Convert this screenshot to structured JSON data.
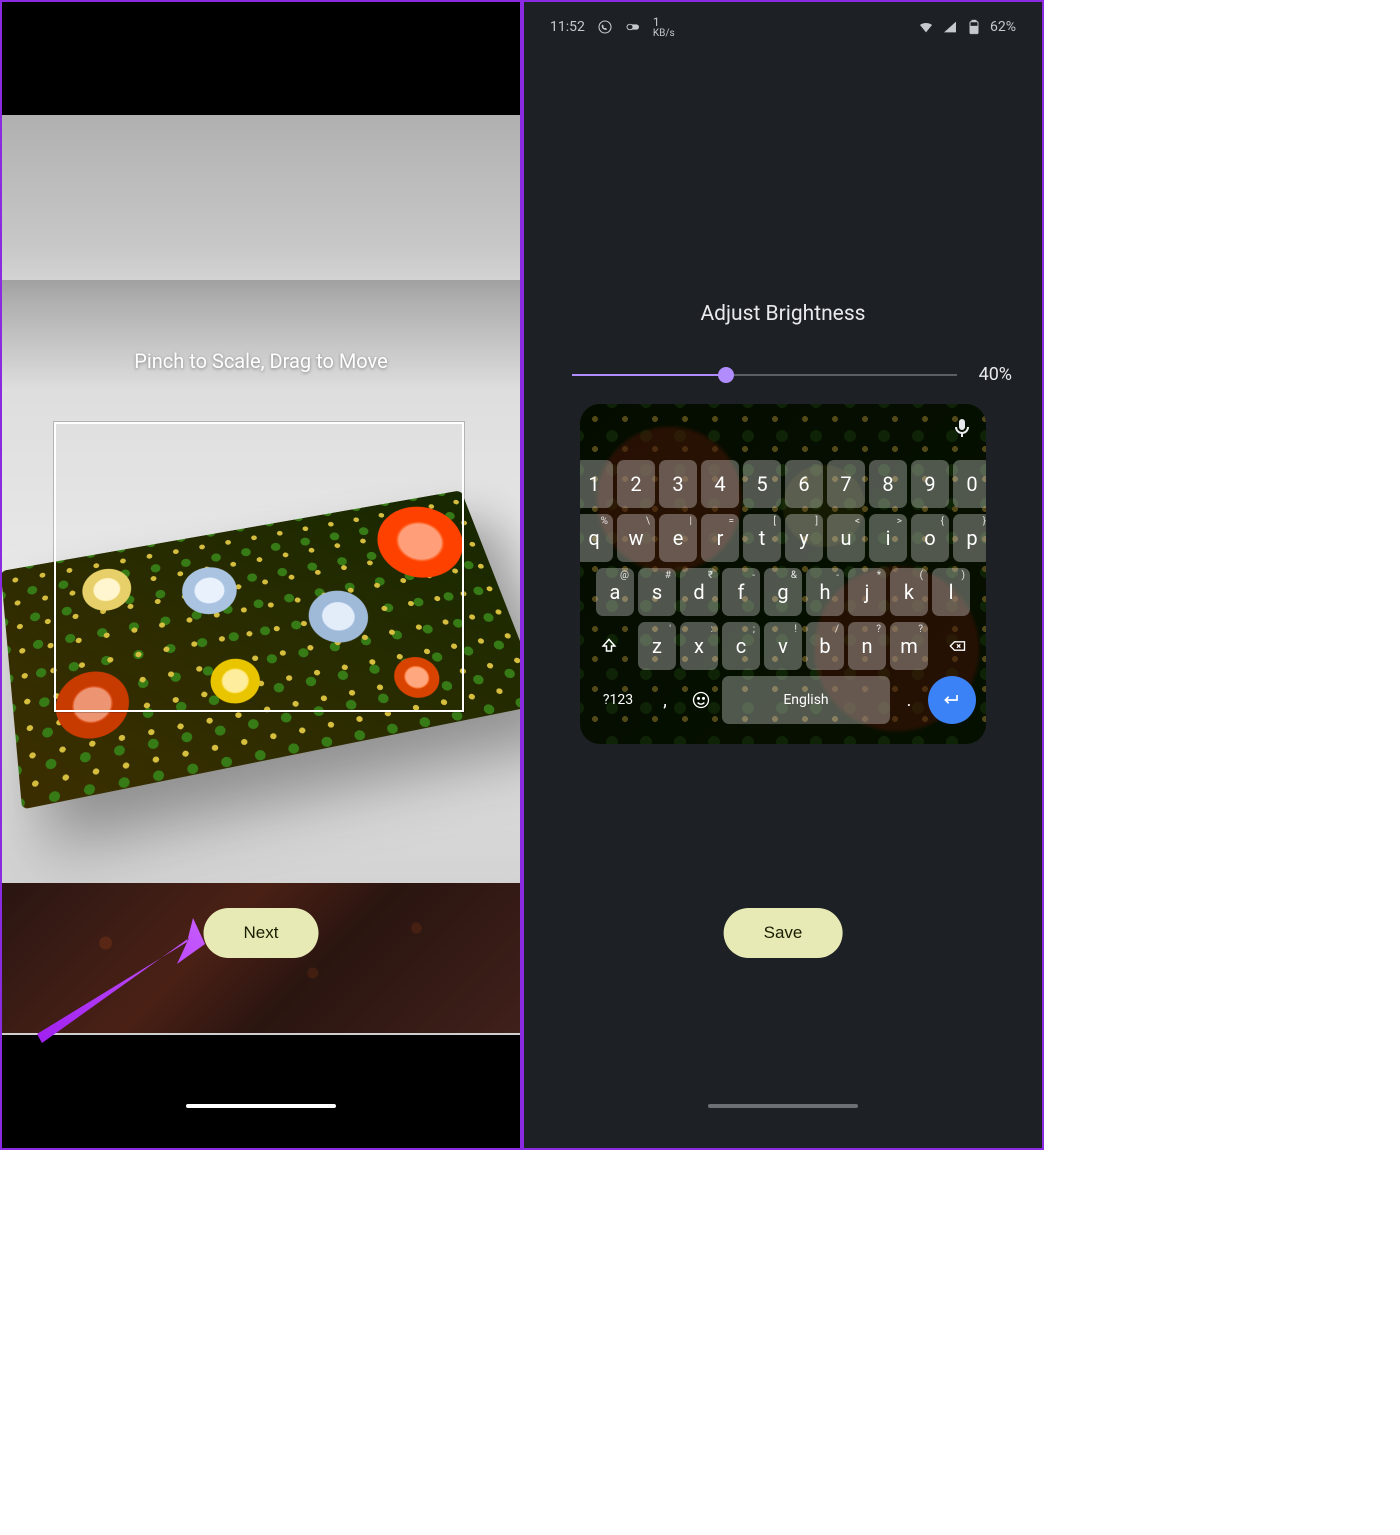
{
  "left": {
    "hint": "Pinch to Scale, Drag to Move",
    "next_label": "Next"
  },
  "right": {
    "status": {
      "time": "11:52",
      "net_value": "1",
      "net_unit": "KB/s",
      "battery_text": "62%"
    },
    "title": "Adjust Brightness",
    "brightness_pct": 40,
    "brightness_label": "40%",
    "save_label": "Save",
    "keyboard": {
      "space_label": "English",
      "sym_label": "?123",
      "row_nums": [
        "1",
        "2",
        "3",
        "4",
        "5",
        "6",
        "7",
        "8",
        "9",
        "0"
      ],
      "row_q": [
        [
          "q",
          "%"
        ],
        [
          "w",
          "\\"
        ],
        [
          "e",
          "|"
        ],
        [
          "r",
          "="
        ],
        [
          "t",
          "["
        ],
        [
          "y",
          "]"
        ],
        [
          "u",
          "<"
        ],
        [
          "i",
          ">"
        ],
        [
          "o",
          "{"
        ],
        [
          "p",
          "}"
        ]
      ],
      "row_a": [
        [
          "a",
          "@"
        ],
        [
          "s",
          "#"
        ],
        [
          "d",
          "₹"
        ],
        [
          "f",
          "-"
        ],
        [
          "g",
          "&"
        ],
        [
          "h",
          "-"
        ],
        [
          "j",
          "*"
        ],
        [
          "k",
          "("
        ],
        [
          "l",
          ")"
        ]
      ],
      "row_z": [
        [
          "z",
          "'"
        ],
        [
          "x",
          ":"
        ],
        [
          "c",
          ";"
        ],
        [
          "v",
          "!"
        ],
        [
          "b",
          "/"
        ],
        [
          "n",
          "?"
        ],
        [
          "m",
          "?"
        ]
      ]
    }
  }
}
